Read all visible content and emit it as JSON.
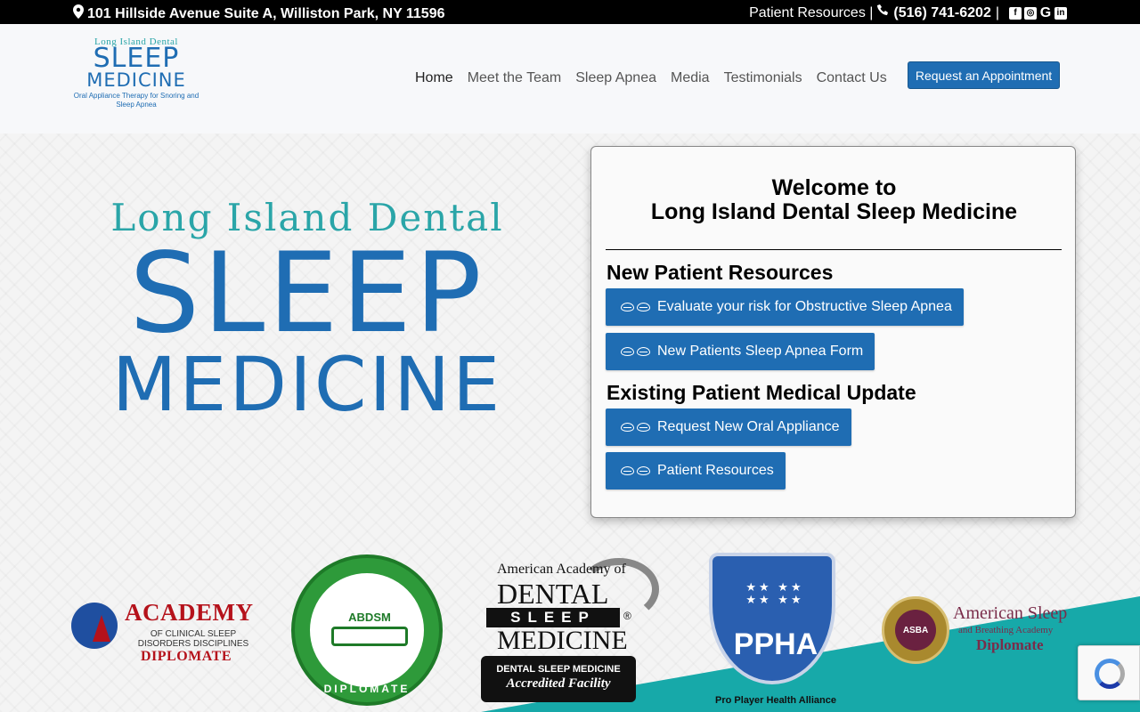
{
  "topbar": {
    "address": "101 Hillside Avenue Suite A, Williston Park, NY 11596",
    "patient_resources": "Patient Resources |",
    "phone": "(516) 741-6202",
    "social": [
      "facebook-icon",
      "instagram-icon",
      "google-icon",
      "linkedin-icon"
    ]
  },
  "logo": {
    "line1": "Long Island Dental",
    "line2": "SLEEP",
    "line3": "MEDICINE",
    "tagline": "Oral Appliance Therapy for Snoring and Sleep Apnea"
  },
  "nav": {
    "items": [
      "Home",
      "Meet the Team",
      "Sleep Apnea",
      "Media",
      "Testimonials",
      "Contact Us"
    ],
    "cta": "Request an Appointment"
  },
  "hero": {
    "line1": "Long Island Dental",
    "line2": "SLEEP",
    "line3": "MEDICINE"
  },
  "welcome": {
    "title_line1": "Welcome to",
    "title_line2": "Long Island Dental Sleep Medicine",
    "new_patient_heading": "New Patient Resources",
    "new_patient_buttons": [
      "Evaluate your risk for Obstructive Sleep Apnea",
      "New Patients Sleep Apnea Form"
    ],
    "existing_heading": "Existing Patient Medical Update",
    "existing_buttons": [
      "Request New Oral Appliance",
      "Patient Resources"
    ]
  },
  "badges": {
    "acad": {
      "t1": "ACADEMY",
      "t2": "OF CLINICAL SLEEP DISORDERS DISCIPLINES",
      "t3": "DIPLOMATE"
    },
    "abdsm": {
      "label": "ABDSM",
      "dip": "DIPLOMATE"
    },
    "aadsm": {
      "a1": "American Academy of",
      "a2": "DENTAL",
      "a3": "SLEEP",
      "a4": "MEDICINE",
      "reg": "®",
      "c1": "DENTAL SLEEP MEDICINE",
      "c2": "Accredited Facility"
    },
    "ppha": {
      "text": "PPHA",
      "caption": "Pro Player Health Alliance"
    },
    "asba": {
      "seal": "ASBA",
      "s1": "American Sleep",
      "s2": "and Breathing Academy",
      "s3": "Diplomate"
    }
  },
  "colors": {
    "brand_blue": "#1f6db3",
    "teal": "#2aa5a8",
    "topbar": "#000000",
    "wedge": "#17a9a9"
  }
}
